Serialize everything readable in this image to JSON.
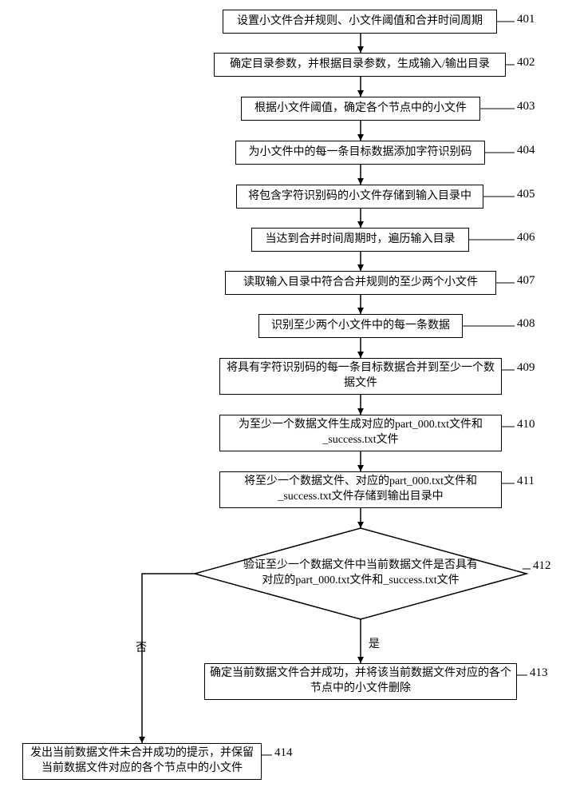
{
  "flow": {
    "steps": {
      "s401": "设置小文件合并规则、小文件阈值和合并时间周期",
      "s402": "确定目录参数，并根据目录参数，生成输入/输出目录",
      "s403": "根据小文件阈值，确定各个节点中的小文件",
      "s404": "为小文件中的每一条目标数据添加字符识别码",
      "s405": "将包含字符识别码的小文件存储到输入目录中",
      "s406": "当达到合并时间周期时，遍历输入目录",
      "s407": "读取输入目录中符合合并规则的至少两个小文件",
      "s408": "识别至少两个小文件中的每一条数据",
      "s409": "将具有字符识别码的每一条目标数据合并到至少一个数据文件",
      "s410": "为至少一个数据文件生成对应的part_000.txt文件和_success.txt文件",
      "s411": "将至少一个数据文件、对应的part_000.txt文件和_success.txt文件存储到输出目录中",
      "s412": "验证至少一个数据文件中当前数据文件是否具有对应的part_000.txt文件和_success.txt文件",
      "s413": "确定当前数据文件合并成功，并将该当前数据文件对应的各个节点中的小文件删除",
      "s414": "发出当前数据文件未合并成功的提示，并保留当前数据文件对应的各个节点中的小文件"
    },
    "refs": {
      "r401": "401",
      "r402": "402",
      "r403": "403",
      "r404": "404",
      "r405": "405",
      "r406": "406",
      "r407": "407",
      "r408": "408",
      "r409": "409",
      "r410": "410",
      "r411": "411",
      "r412": "412",
      "r413": "413",
      "r414": "414"
    },
    "branches": {
      "yes": "是",
      "no": "否"
    }
  },
  "chart_data": {
    "type": "flowchart",
    "nodes": [
      {
        "id": "401",
        "type": "process",
        "label": "设置小文件合并规则、小文件阈值和合并时间周期"
      },
      {
        "id": "402",
        "type": "process",
        "label": "确定目录参数，并根据目录参数，生成输入/输出目录"
      },
      {
        "id": "403",
        "type": "process",
        "label": "根据小文件阈值，确定各个节点中的小文件"
      },
      {
        "id": "404",
        "type": "process",
        "label": "为小文件中的每一条目标数据添加字符识别码"
      },
      {
        "id": "405",
        "type": "process",
        "label": "将包含字符识别码的小文件存储到输入目录中"
      },
      {
        "id": "406",
        "type": "process",
        "label": "当达到合并时间周期时，遍历输入目录"
      },
      {
        "id": "407",
        "type": "process",
        "label": "读取输入目录中符合合并规则的至少两个小文件"
      },
      {
        "id": "408",
        "type": "process",
        "label": "识别至少两个小文件中的每一条数据"
      },
      {
        "id": "409",
        "type": "process",
        "label": "将具有字符识别码的每一条目标数据合并到至少一个数据文件"
      },
      {
        "id": "410",
        "type": "process",
        "label": "为至少一个数据文件生成对应的part_000.txt文件和_success.txt文件"
      },
      {
        "id": "411",
        "type": "process",
        "label": "将至少一个数据文件、对应的part_000.txt文件和_success.txt文件存储到输出目录中"
      },
      {
        "id": "412",
        "type": "decision",
        "label": "验证至少一个数据文件中当前数据文件是否具有对应的part_000.txt文件和_success.txt文件"
      },
      {
        "id": "413",
        "type": "process",
        "label": "确定当前数据文件合并成功，并将该当前数据文件对应的各个节点中的小文件删除"
      },
      {
        "id": "414",
        "type": "process",
        "label": "发出当前数据文件未合并成功的提示，并保留当前数据文件对应的各个节点中的小文件"
      }
    ],
    "edges": [
      {
        "from": "401",
        "to": "402"
      },
      {
        "from": "402",
        "to": "403"
      },
      {
        "from": "403",
        "to": "404"
      },
      {
        "from": "404",
        "to": "405"
      },
      {
        "from": "405",
        "to": "406"
      },
      {
        "from": "406",
        "to": "407"
      },
      {
        "from": "407",
        "to": "408"
      },
      {
        "from": "408",
        "to": "409"
      },
      {
        "from": "409",
        "to": "410"
      },
      {
        "from": "410",
        "to": "411"
      },
      {
        "from": "411",
        "to": "412"
      },
      {
        "from": "412",
        "to": "413",
        "label": "是"
      },
      {
        "from": "412",
        "to": "414",
        "label": "否"
      }
    ]
  }
}
